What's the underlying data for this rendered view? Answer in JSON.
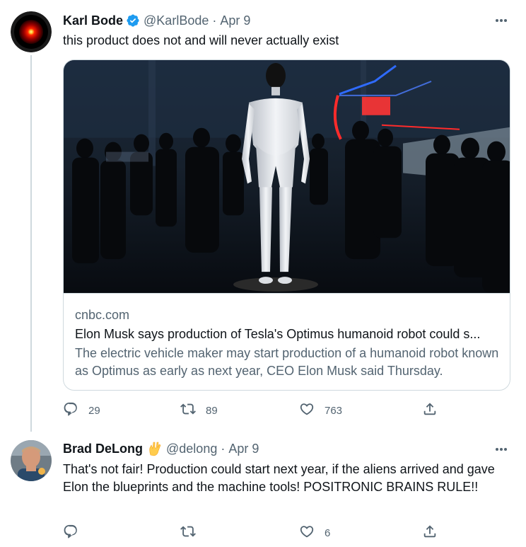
{
  "tweets": [
    {
      "author_name": "Karl Bode",
      "handle": "@KarlBode",
      "separator": "·",
      "date": "Apr 9",
      "text": "this product does not and will never actually exist",
      "card": {
        "domain": "cnbc.com",
        "title": "Elon Musk says production of Tesla's Optimus humanoid robot could s...",
        "description": "The electric vehicle maker may start production of a humanoid robot known as Optimus as early as next year, CEO Elon Musk said Thursday."
      },
      "actions": {
        "replies": "29",
        "retweets": "89",
        "likes": "763"
      }
    },
    {
      "author_name": "Brad DeLong",
      "handle": "@delong",
      "separator": "·",
      "date": "Apr 9",
      "text": "That's not fair! Production could start next year, if the aliens arrived and gave Elon the blueprints and the machine tools! POSITRONIC BRAINS RULE!!",
      "actions": {
        "replies": "",
        "retweets": "",
        "likes": "6"
      }
    }
  ],
  "colors": {
    "text": "#0f1419",
    "secondary": "#536471",
    "verified": "#1d9bf0",
    "border": "#cfd9de"
  },
  "icons": [
    "more-icon",
    "verified-badge-icon",
    "vulcan-salute-emoji",
    "reply-icon",
    "retweet-icon",
    "like-icon",
    "share-icon"
  ]
}
